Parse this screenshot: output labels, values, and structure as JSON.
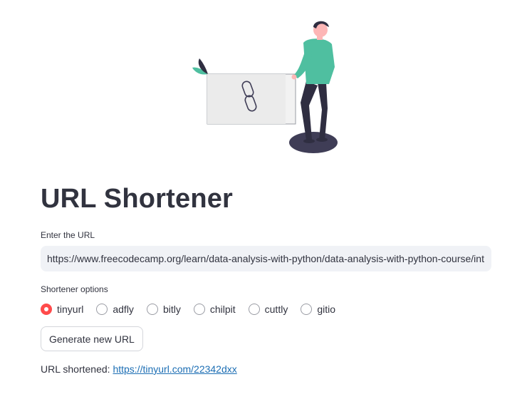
{
  "title": "URL Shortener",
  "url_field": {
    "label": "Enter the URL",
    "value": "https://www.freecodecamp.org/learn/data-analysis-with-python/data-analysis-with-python-course/int"
  },
  "options": {
    "label": "Shortener options",
    "items": [
      "tinyurl",
      "adfly",
      "bitly",
      "chilpit",
      "cuttly",
      "gitio"
    ],
    "selected": "tinyurl"
  },
  "button_label": "Generate new URL",
  "result": {
    "prefix": "URL shortened:",
    "link": "https://tinyurl.com/22342dxx"
  },
  "colors": {
    "accent": "#ff4b4b",
    "link": "#1c6eb4",
    "illustration_teal": "#4fbfa0",
    "illustration_dark": "#2f2e41"
  }
}
